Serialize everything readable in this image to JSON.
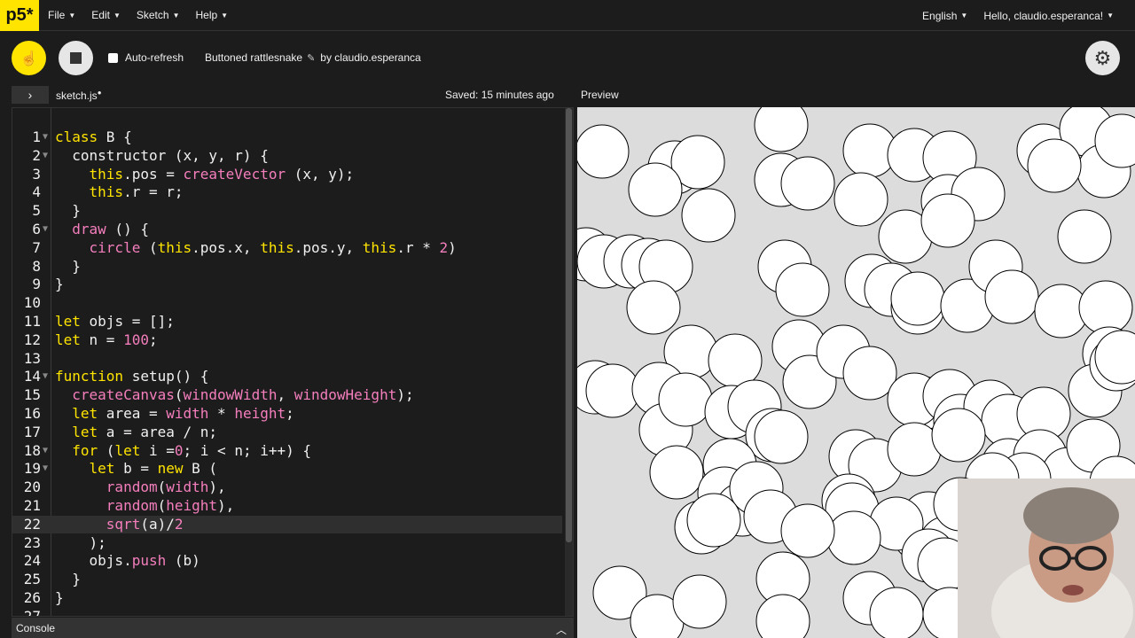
{
  "nav": {
    "logo": "p5*",
    "menus": [
      "File",
      "Edit",
      "Sketch",
      "Help"
    ],
    "language": "English",
    "user": "Hello, claudio.esperanca!"
  },
  "toolbar": {
    "autorefresh_label": "Auto-refresh",
    "sketch_name": "Buttoned rattlesnake",
    "author": "by claudio.esperanca",
    "play_icon": "play-icon",
    "stop_icon": "stop-icon",
    "settings_icon": "gear-icon"
  },
  "tabs": {
    "file": "sketch.js",
    "saved_status": "Saved: 15 minutes ago",
    "preview_label": "Preview"
  },
  "editor": {
    "active_line": 22,
    "lines": [
      "class B {",
      "  constructor (x, y, r) {",
      "    this.pos = createVector (x, y);",
      "    this.r = r;",
      "  }",
      "  draw () {",
      "    circle (this.pos.x, this.pos.y, this.r * 2)",
      "  }",
      "}",
      "",
      "let objs = [];",
      "let n = 100;",
      "",
      "function setup() {",
      "  createCanvas(windowWidth, windowHeight);",
      "  let area = width * height;",
      "  let a = area / n;",
      "  for (let i =0; i < n; i++) {",
      "    let b = new B (",
      "      random(width),",
      "      random(height),",
      "      sqrt(a)/2",
      "    );",
      "    objs.push (b)",
      "  }",
      "}",
      ""
    ],
    "foldable_lines": [
      1,
      2,
      6,
      14,
      18,
      19
    ]
  },
  "console": {
    "label": "Console"
  },
  "colors": {
    "accent": "#ffe400",
    "pink": "#f57ebd",
    "bg": "#1c1c1c",
    "canvas_bg": "#dcdcdc"
  }
}
